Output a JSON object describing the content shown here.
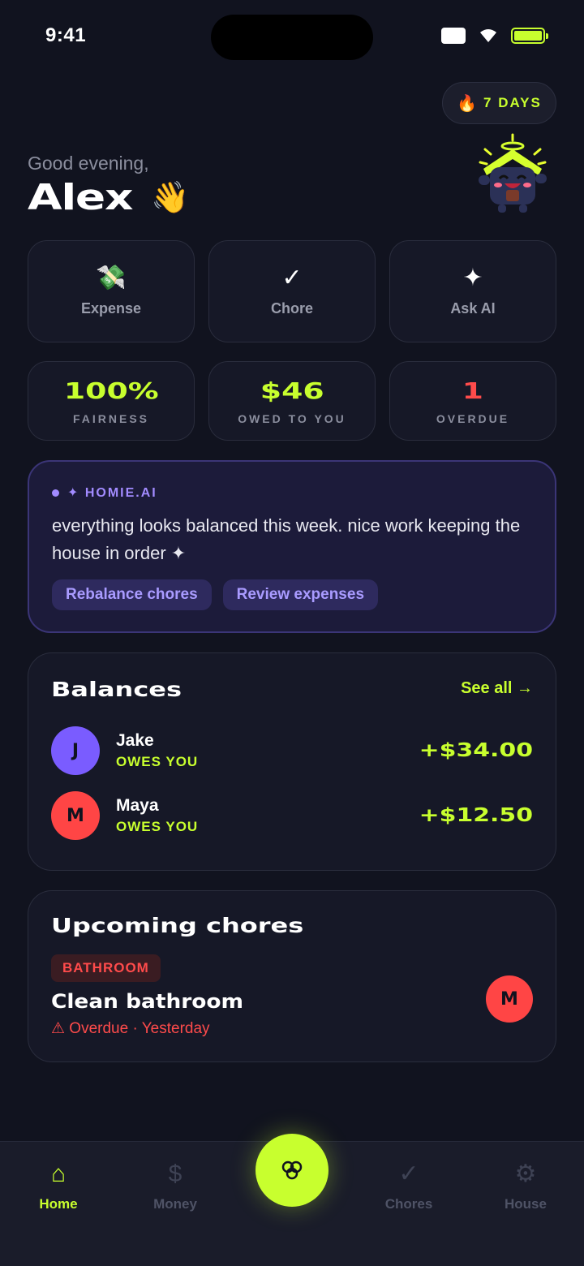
{
  "status": {
    "time": "9:41"
  },
  "streak": {
    "icon": "fire-icon",
    "label": "7 DAYS"
  },
  "greeting": {
    "line": "Good evening,",
    "name": "Alex",
    "emoji": "👋"
  },
  "actions": [
    {
      "icon": "💸",
      "label": "Expense"
    },
    {
      "icon": "✓",
      "label": "Chore"
    },
    {
      "icon": "✦",
      "label": "Ask AI"
    }
  ],
  "stats": [
    {
      "value": "100%",
      "caption": "FAIRNESS"
    },
    {
      "value": "$46",
      "caption": "OWED TO YOU"
    },
    {
      "value": "1",
      "caption": "OVERDUE"
    }
  ],
  "ai": {
    "brand": "✦ HOMIE.AI",
    "message": "everything looks balanced this week. nice work keeping the house in order ✦",
    "chips": [
      "Rebalance chores",
      "Review expenses"
    ]
  },
  "balances": {
    "title": "Balances",
    "see_all": "See all →",
    "rows": [
      {
        "initial": "J",
        "name": "Jake",
        "status": "OWES YOU",
        "amount": "+$34.00"
      },
      {
        "initial": "M",
        "name": "Maya",
        "status": "OWES YOU",
        "amount": "+$12.50"
      }
    ]
  },
  "chores": {
    "title": "Upcoming chores",
    "tag": "BATHROOM",
    "name": "Clean bathroom",
    "meta": "⚠ Overdue · Yesterday",
    "assignee_initial": "M"
  },
  "nav": [
    {
      "icon": "⌂",
      "label": "Home"
    },
    {
      "icon": "$",
      "label": "Money"
    },
    {
      "icon": "✓",
      "label": "Chores"
    },
    {
      "icon": "⚙",
      "label": "House"
    }
  ],
  "colors": {
    "accent": "#c8ff2e",
    "danger": "#ff4b4b",
    "ai": "#a28bff",
    "background": "#11131f"
  }
}
